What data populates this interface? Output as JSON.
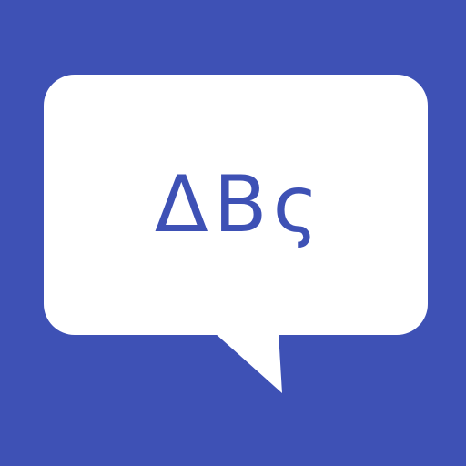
{
  "app": {
    "icon_name": "speech-bubble-abc-icon",
    "colors": {
      "background": "#3E51B5",
      "bubble": "#FFFFFF",
      "text": "#3E51B5"
    }
  },
  "bubble": {
    "text": "ΔBς"
  }
}
